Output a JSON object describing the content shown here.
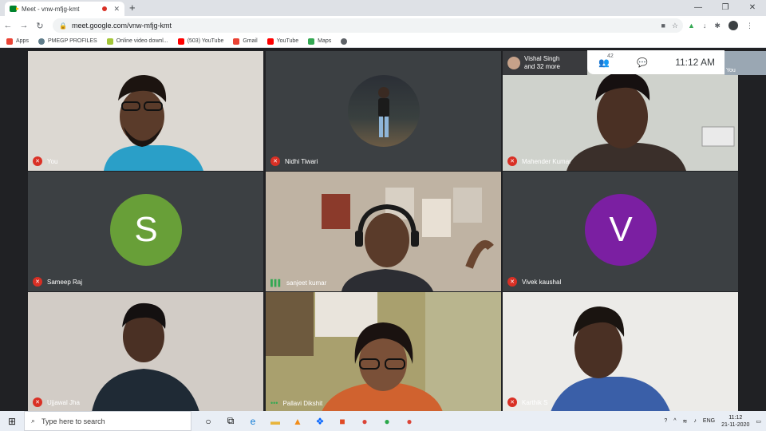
{
  "browser": {
    "tab_title": "Meet - vnw-mfjg-kmt",
    "new_tab": "+",
    "window_controls": [
      "—",
      "❐",
      "✕"
    ],
    "url": "meet.google.com/vnw-mfjg-kmt",
    "bookmarks": [
      {
        "label": "Apps",
        "icon": "apps-grid-icon",
        "color": "#ea4335"
      },
      {
        "label": "PMEGP PROFILES",
        "icon": "pmegp-logo-icon",
        "color": "#607d8b"
      },
      {
        "label": "Online video downl...",
        "icon": "android-icon",
        "color": "#a4c639"
      },
      {
        "label": "(503) YouTube",
        "icon": "youtube-icon",
        "color": "#ff0000"
      },
      {
        "label": "Gmail",
        "icon": "gmail-icon",
        "color": "#ea4335"
      },
      {
        "label": "YouTube",
        "icon": "youtube-icon",
        "color": "#ff0000"
      },
      {
        "label": "Maps",
        "icon": "maps-icon",
        "color": "#34a853"
      },
      {
        "label": "",
        "icon": "globe-icon",
        "color": "#5f6368"
      }
    ]
  },
  "meet": {
    "participant_panel": {
      "name": "Vishal Singh",
      "more": "and 32 more"
    },
    "people_count": "42",
    "time": "11:12 AM",
    "self_label": "You",
    "tiles": [
      {
        "name": "You",
        "mic": "muted",
        "kind": "video"
      },
      {
        "name": "Nidhi Tiwari",
        "mic": "muted",
        "kind": "photo"
      },
      {
        "name": "Mahender Kumar",
        "mic": "muted",
        "kind": "video"
      },
      {
        "name": "Sameep Raj",
        "mic": "muted",
        "kind": "letter",
        "letter": "S",
        "color": "#689f38"
      },
      {
        "name": "sanjeet kumar",
        "mic": "speaking",
        "kind": "video"
      },
      {
        "name": "Vivek kaushal",
        "mic": "muted",
        "kind": "letter",
        "letter": "V",
        "color": "#7b1fa2"
      },
      {
        "name": "Ujjawal Jha",
        "mic": "muted",
        "kind": "video"
      },
      {
        "name": "Pallavi Dikshit",
        "mic": "active",
        "kind": "video"
      },
      {
        "name": "Karthik S",
        "mic": "muted",
        "kind": "video"
      }
    ]
  },
  "taskbar": {
    "search_placeholder": "Type here to search",
    "lang": "ENG",
    "time": "11:12",
    "date": "21-11-2020"
  }
}
